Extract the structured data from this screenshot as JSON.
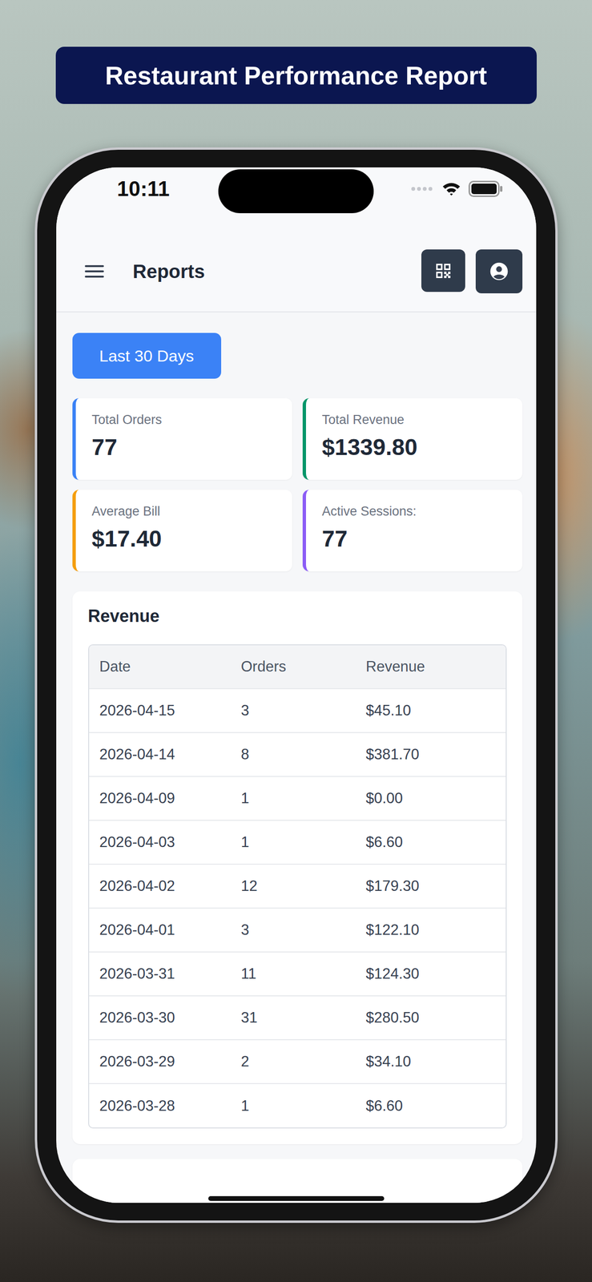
{
  "banner": {
    "title": "Restaurant Performance Report"
  },
  "status_bar": {
    "time": "10:11"
  },
  "header": {
    "title": "Reports"
  },
  "filter": {
    "label": "Last 30 Days"
  },
  "stats": [
    {
      "label": "Total Orders",
      "value": "77",
      "color": "#3b82f6"
    },
    {
      "label": "Total Revenue",
      "value": "$1339.80",
      "color": "#059669"
    },
    {
      "label": "Average Bill",
      "value": "$17.40",
      "color": "#f59e0b"
    },
    {
      "label": "Active Sessions:",
      "value": "77",
      "color": "#8b5cf6"
    }
  ],
  "revenue": {
    "title": "Revenue",
    "columns": [
      "Date",
      "Orders",
      "Revenue"
    ],
    "rows": [
      [
        "2026-04-15",
        "3",
        "$45.10"
      ],
      [
        "2026-04-14",
        "8",
        "$381.70"
      ],
      [
        "2026-04-09",
        "1",
        "$0.00"
      ],
      [
        "2026-04-03",
        "1",
        "$6.60"
      ],
      [
        "2026-04-02",
        "12",
        "$179.30"
      ],
      [
        "2026-04-01",
        "3",
        "$122.10"
      ],
      [
        "2026-03-31",
        "11",
        "$124.30"
      ],
      [
        "2026-03-30",
        "31",
        "$280.50"
      ],
      [
        "2026-03-29",
        "2",
        "$34.10"
      ],
      [
        "2026-03-28",
        "1",
        "$6.60"
      ]
    ]
  }
}
